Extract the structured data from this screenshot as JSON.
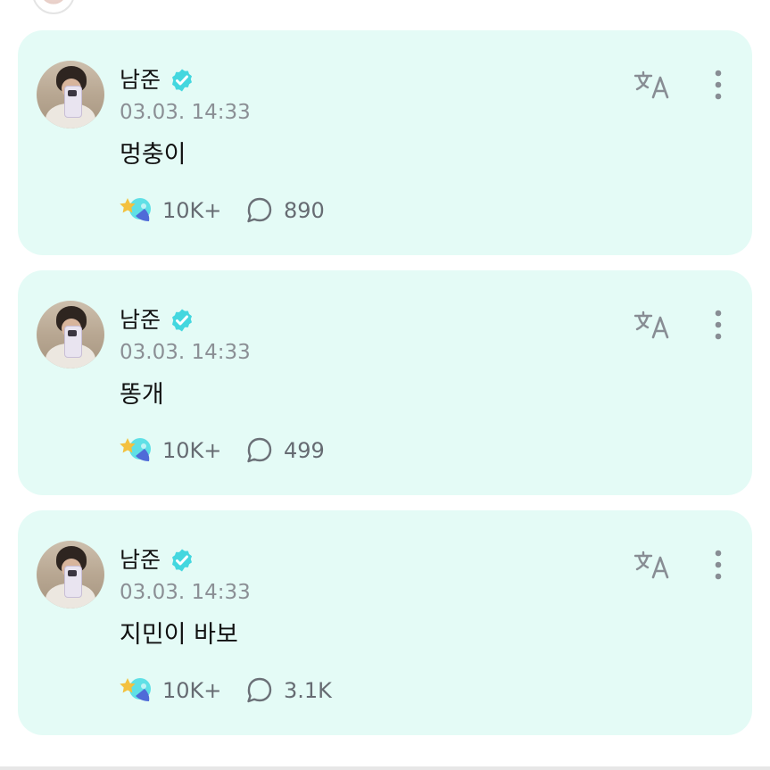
{
  "top_preview": {
    "avatar_icon": "profile-avatar"
  },
  "posts": [
    {
      "author": "남준",
      "time": "03.03. 14:33",
      "text": "멍충이",
      "likes": "10K+",
      "comments": "890"
    },
    {
      "author": "남준",
      "time": "03.03. 14:33",
      "text": "똥개",
      "likes": "10K+",
      "comments": "499"
    },
    {
      "author": "남준",
      "time": "03.03. 14:33",
      "text": "지민이 바보",
      "likes": "10K+",
      "comments": "3.1K"
    }
  ],
  "icons": {
    "verified": "verified-badge-icon",
    "translate": "translate-icon",
    "more": "more-options-icon",
    "like": "reaction-icon",
    "comment": "comment-icon"
  },
  "colors": {
    "card_background": "#e4fbf6",
    "accent": "#44d7df",
    "secondary_text": "#8b8f95"
  }
}
